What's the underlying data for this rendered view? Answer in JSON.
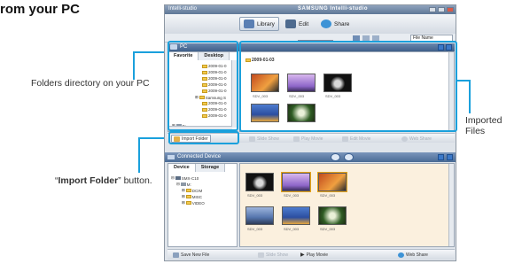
{
  "heading": "rom your PC",
  "callouts": {
    "folders": "Folders directory on your PC",
    "imported": "Imported Files",
    "import_folder_bold": "Import Folder",
    "import_folder_rest": "button."
  },
  "window": {
    "title": "Intelli-studio",
    "brand": "SAMSUNG Intelli-studio",
    "toolbar": {
      "library": "Library",
      "edit": "Edit",
      "share": "Share"
    },
    "sort_select": "File Name",
    "pc_panel": {
      "title": "PC",
      "tabs": [
        "Favorite",
        "Desktop"
      ],
      "tree": [
        "2009-01-0",
        "2009-01-0",
        "2009-01-0",
        "2009-01-0",
        "2009-01-0",
        "Samsung S",
        "2009-01-0",
        "2009-01-0",
        "2009-01-0",
        "F:"
      ],
      "folder_label": "2009-01-03",
      "thumb_caption": "SDV_003",
      "actions": {
        "import": "Import Folder",
        "slide": "Slide Show",
        "play": "Play Movie",
        "edit": "Edit Movie",
        "web": "Web Share"
      }
    },
    "device_panel": {
      "title": "Connected Device",
      "tabs": [
        "Device",
        "Storage"
      ],
      "tree": [
        "SMX-C10",
        "M:",
        "DCIM",
        "MISC",
        "VIDEO"
      ],
      "thumb_caption": "SDV_003",
      "actions": {
        "save": "Save New File",
        "slide": "Slide Show",
        "play": "Play Movie",
        "web": "Web Share"
      }
    }
  },
  "colors": {
    "callout_line": "#1aa0dc",
    "header_blue": "#3f5f89",
    "device_bg": "#fbf0de"
  }
}
